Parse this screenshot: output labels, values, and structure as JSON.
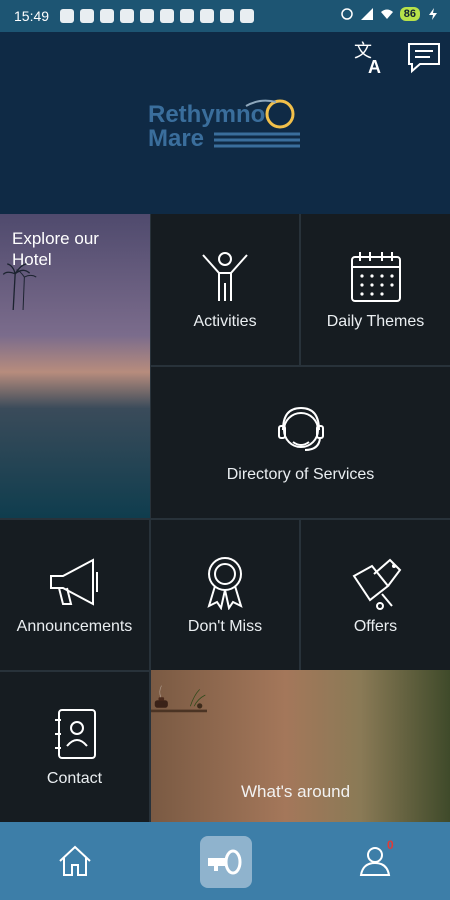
{
  "status_bar": {
    "time": "15:49",
    "battery": "86"
  },
  "header": {
    "logo_text_line1": "Rethymno",
    "logo_text_line2": "Mare"
  },
  "tiles": {
    "explore": "Explore our Hotel",
    "activities": "Activities",
    "daily_themes": "Daily Themes",
    "directory": "Directory of Services",
    "announcements": "Announcements",
    "dont_miss": "Don't Miss",
    "offers": "Offers",
    "contact": "Contact",
    "whats_around": "What's around"
  },
  "bottom_nav": {
    "notifications_badge": "0"
  },
  "colors": {
    "status_bar": "#1d5573",
    "header": "#0f2a45",
    "tile": "#161c21",
    "nav": "#3d7ea8",
    "badge": "#e53935"
  }
}
